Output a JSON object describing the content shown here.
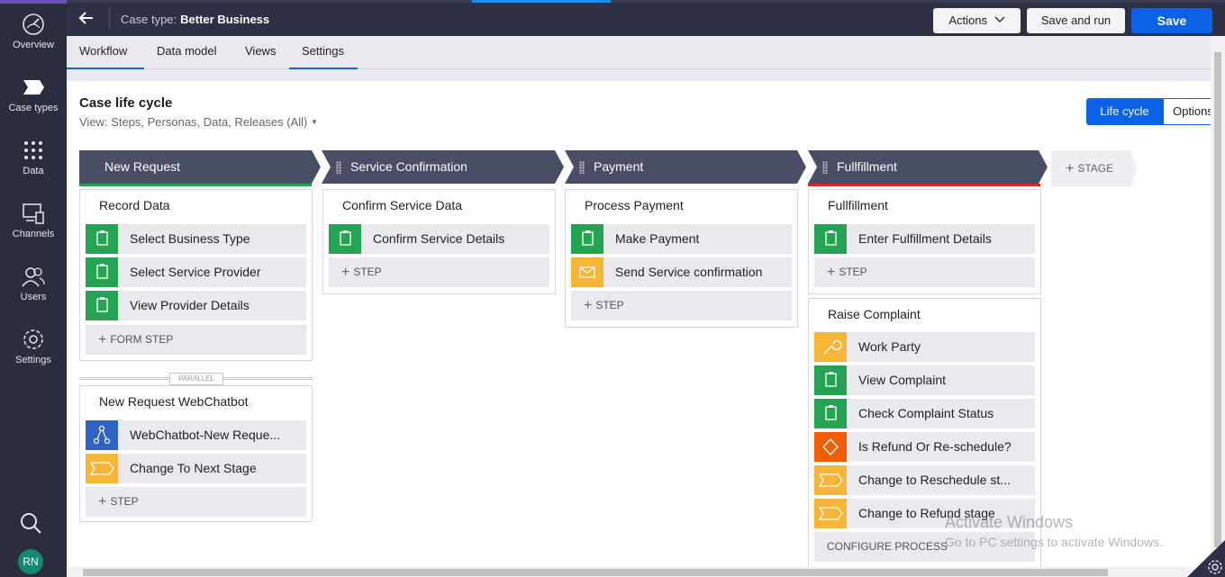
{
  "nav": {
    "items": [
      {
        "label": "Overview",
        "icon": "speedometer-icon"
      },
      {
        "label": "Case types",
        "icon": "case-type-chevron-icon"
      },
      {
        "label": "Data",
        "icon": "grid-dots-icon"
      },
      {
        "label": "Channels",
        "icon": "devices-icon"
      },
      {
        "label": "Users",
        "icon": "users-icon"
      },
      {
        "label": "Settings",
        "icon": "gear-icon"
      }
    ],
    "avatar": "RN"
  },
  "header": {
    "case_type_label": "Case type:",
    "case_type_name": "Better Business",
    "actions_label": "Actions",
    "save_run_label": "Save and run",
    "save_label": "Save"
  },
  "tabs": [
    "Workflow",
    "Data model",
    "Views",
    "Settings"
  ],
  "main": {
    "title": "Case life cycle",
    "view_label": "View: Steps, Personas, Data, Releases (All)",
    "toggle_lifecycle": "Life cycle",
    "toggle_options": "Options"
  },
  "stages": [
    {
      "name": "New Request"
    },
    {
      "name": "Service Confirmation"
    },
    {
      "name": "Payment"
    },
    {
      "name": "Fullfillment"
    }
  ],
  "add_stage_label": "STAGE",
  "processes": {
    "record_data": {
      "name": "Record Data",
      "steps": [
        "Select Business Type",
        "Select Service Provider",
        "View Provider Details"
      ],
      "add": "FORM STEP"
    },
    "webchatbot": {
      "name": "New Request WebChatbot",
      "steps": [
        "WebChatbot-New Reque...",
        "Change To Next Stage"
      ],
      "add": "STEP"
    },
    "confirm_service": {
      "name": "Confirm Service Data",
      "steps": [
        "Confirm Service Details"
      ],
      "add": "STEP"
    },
    "process_payment": {
      "name": "Process Payment",
      "steps": [
        "Make Payment",
        "Send Service confirmation"
      ],
      "add": "STEP"
    },
    "fulfillment": {
      "name": "Fullfillment",
      "steps": [
        "Enter Fulfillment Details"
      ],
      "add": "STEP"
    },
    "raise_complaint": {
      "name": "Raise Complaint",
      "steps": [
        "Work Party",
        "View Complaint",
        "Check Complaint Status",
        "Is Refund Or Re-schedule?",
        "Change to Reschedule st...",
        "Change to Refund stage"
      ],
      "add": "CONFIGURE PROCESS"
    }
  },
  "parallel_label": "PARALLEL",
  "watermark": {
    "line1": "Activate Windows",
    "line2": "Go to PC settings to activate Windows."
  }
}
